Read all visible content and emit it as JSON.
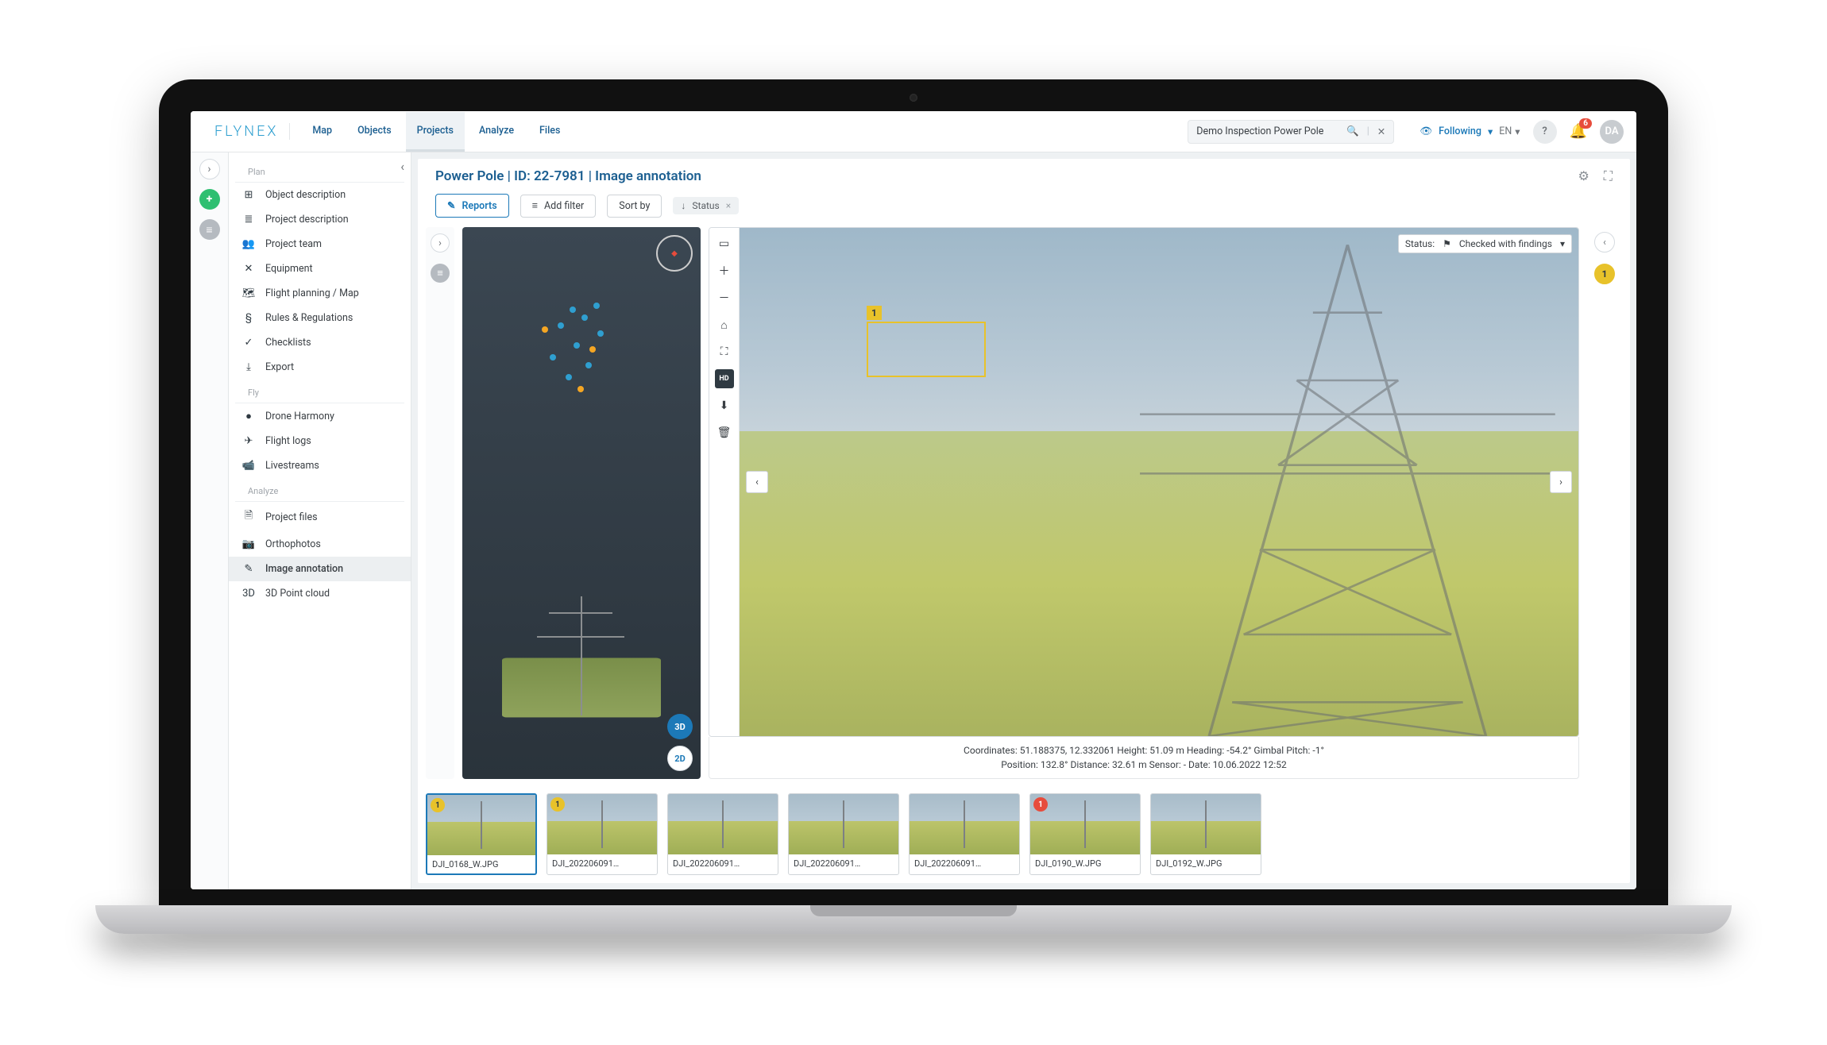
{
  "brand": "FLYNEX",
  "nav": [
    "Map",
    "Objects",
    "Projects",
    "Analyze",
    "Files"
  ],
  "nav_active_index": 2,
  "search": {
    "value": "Demo Inspection Power Pole"
  },
  "following_label": "Following",
  "language": "EN",
  "notification_count": "6",
  "user_initials": "DA",
  "sidebar": {
    "sections": [
      {
        "title": "Plan",
        "items": [
          {
            "icon": "⊞",
            "label": "Object description"
          },
          {
            "icon": "≣",
            "label": "Project description"
          },
          {
            "icon": "👥",
            "label": "Project team"
          },
          {
            "icon": "✕",
            "label": "Equipment"
          },
          {
            "icon": "🗺",
            "label": "Flight planning / Map"
          },
          {
            "icon": "§",
            "label": "Rules & Regulations"
          },
          {
            "icon": "✓",
            "label": "Checklists"
          },
          {
            "icon": "⤓",
            "label": "Export"
          }
        ]
      },
      {
        "title": "Fly",
        "items": [
          {
            "icon": "●",
            "label": "Drone Harmony"
          },
          {
            "icon": "✈",
            "label": "Flight logs"
          },
          {
            "icon": "📹",
            "label": "Livestreams"
          }
        ]
      },
      {
        "title": "Analyze",
        "items": [
          {
            "icon": "🗎",
            "label": "Project files"
          },
          {
            "icon": "📷",
            "label": "Orthophotos"
          },
          {
            "icon": "✎",
            "label": "Image annotation",
            "selected": true
          },
          {
            "icon": "3D",
            "label": "3D Point cloud"
          }
        ]
      }
    ]
  },
  "page_title": "Power Pole | ID: 22-7981 | Image annotation",
  "toolbar": {
    "reports": "Reports",
    "add_filter": "Add filter",
    "sort_by": "Sort by",
    "status_chip": "Status"
  },
  "view3d": {
    "badge_3d": "3D",
    "badge_2d": "2D"
  },
  "status_dropdown": {
    "label": "Status:",
    "value": "Checked with findings"
  },
  "marker_number": "1",
  "right_badge": "1",
  "meta": {
    "line1": "Coordinates: 51.188375, 12.332061    Height: 51.09 m    Heading: -54.2°    Gimbal Pitch: -1°",
    "line2": "Position: 132.8°    Distance: 32.61 m    Sensor: -    Date: 10.06.2022 12:52"
  },
  "thumbnails": [
    {
      "label": "DJI_0168_W.JPG",
      "badge": "1",
      "badge_color": "y",
      "selected": true
    },
    {
      "label": "DJI_202206091…",
      "badge": "1",
      "badge_color": "y"
    },
    {
      "label": "DJI_202206091…"
    },
    {
      "label": "DJI_202206091…"
    },
    {
      "label": "DJI_202206091…"
    },
    {
      "label": "DJI_0190_W.JPG",
      "badge": "1",
      "badge_color": "r"
    },
    {
      "label": "DJI_0192_W.JPG"
    }
  ]
}
